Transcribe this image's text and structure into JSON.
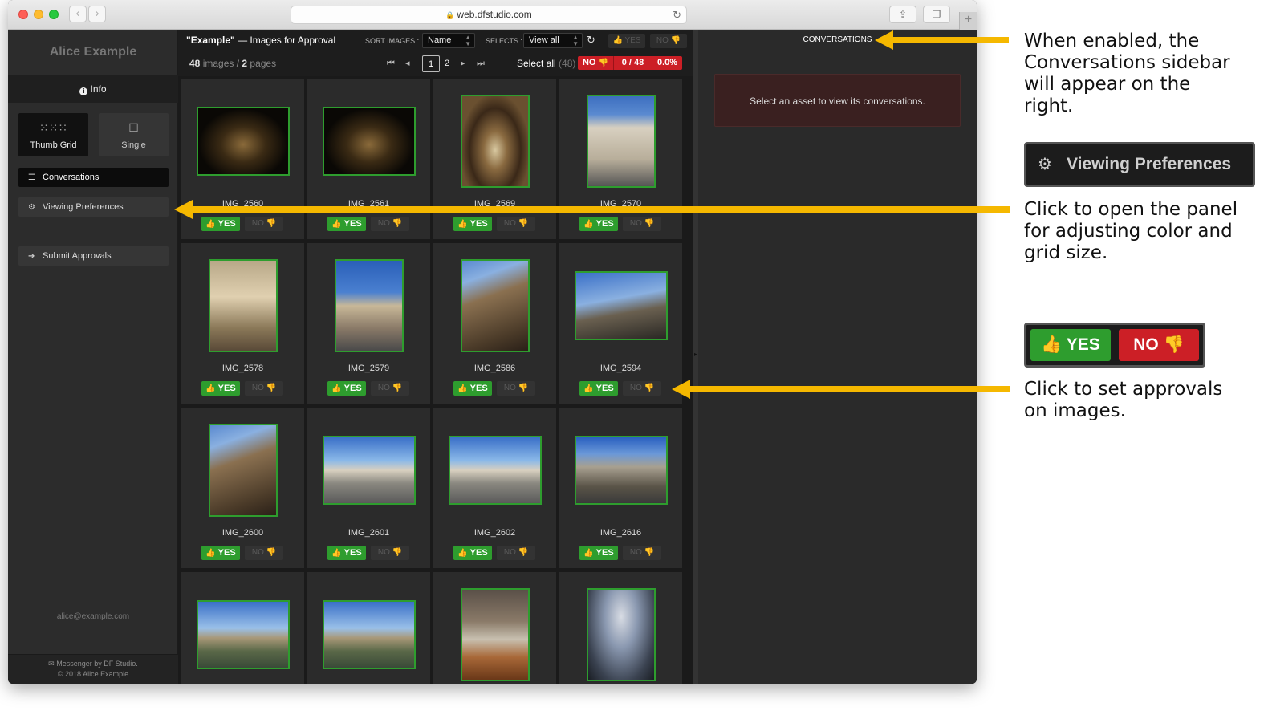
{
  "browser": {
    "url": "web.dfstudio.com"
  },
  "sidebar": {
    "user_name": "Alice Example",
    "info_label": "Info",
    "view_modes": [
      {
        "label": "Thumb Grid"
      },
      {
        "label": "Single"
      }
    ],
    "items": {
      "conversations": "Conversations",
      "viewing_preferences": "Viewing Preferences",
      "submit_approvals": "Submit Approvals"
    },
    "email": "alice@example.com",
    "footer_line1": "Messenger",
    "footer_by": "by DF Studio.",
    "footer_line2": "© 2018 Alice Example"
  },
  "toolbar": {
    "title_bold": "\"Example\"",
    "title_rest": " — Images for Approval",
    "sort_label": "SORT IMAGES :",
    "sort_value": "Name",
    "selects_label": "SELECTS :",
    "selects_value": "View all",
    "yes_label": "YES",
    "no_label": "NO",
    "image_count": "48",
    "images_word": " images / ",
    "page_count": "2",
    "pages_word": " pages",
    "pages": [
      "1",
      "2"
    ],
    "select_all": "Select all",
    "select_all_count": "(48)",
    "no_badge": "NO",
    "approved_ratio": "0 / 48",
    "approved_pct": "0.0%"
  },
  "grid": {
    "yes_label": "YES",
    "no_label": "NO",
    "images": [
      {
        "name": "IMG_2560",
        "scene": "night"
      },
      {
        "name": "IMG_2561",
        "scene": "night"
      },
      {
        "name": "IMG_2569",
        "scene": "arch"
      },
      {
        "name": "IMG_2570",
        "scene": "church"
      },
      {
        "name": "IMG_2578",
        "scene": "statue"
      },
      {
        "name": "IMG_2579",
        "scene": "piazza"
      },
      {
        "name": "IMG_2586",
        "scene": "columns"
      },
      {
        "name": "IMG_2594",
        "scene": "portico"
      },
      {
        "name": "IMG_2600",
        "scene": "columns"
      },
      {
        "name": "IMG_2601",
        "scene": "square"
      },
      {
        "name": "IMG_2602",
        "scene": "square"
      },
      {
        "name": "IMG_2616",
        "scene": "pantheon"
      },
      {
        "name": "",
        "scene": "river"
      },
      {
        "name": "",
        "scene": "river"
      },
      {
        "name": "",
        "scene": "cafe"
      },
      {
        "name": "",
        "scene": "obelisk"
      }
    ]
  },
  "conversations_panel": {
    "title": "CONVERSATIONS",
    "empty_message": "Select an asset to view its conversations."
  },
  "annotations": {
    "conversations_note": [
      "When enabled, the",
      "Conversations sidebar",
      "will appear on the",
      "right."
    ],
    "prefs_callout": "Viewing Preferences",
    "prefs_note": [
      "Click to open the panel",
      "for adjusting color and",
      "grid size."
    ],
    "yes_callout": "YES",
    "no_callout": "NO",
    "approvals_note": [
      "Click to set approvals",
      "on images."
    ],
    "arrow_color": "#f5b800"
  }
}
